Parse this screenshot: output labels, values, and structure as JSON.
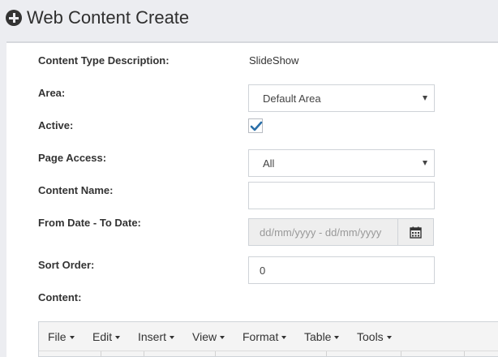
{
  "header": {
    "title": "Web Content Create",
    "icon": "plus-circle-icon"
  },
  "form": {
    "content_type_description": {
      "label": "Content Type Description:",
      "value": "SlideShow"
    },
    "area": {
      "label": "Area:",
      "value": "Default Area"
    },
    "active": {
      "label": "Active:",
      "checked": true
    },
    "page_access": {
      "label": "Page Access:",
      "value": "All"
    },
    "content_name": {
      "label": "Content Name:",
      "value": ""
    },
    "date_range": {
      "label": "From Date - To Date:",
      "placeholder": "dd/mm/yyyy - dd/mm/yyyy",
      "icon": "calendar-icon"
    },
    "sort_order": {
      "label": "Sort Order:",
      "value": "0"
    },
    "content": {
      "label": "Content:"
    }
  },
  "editor": {
    "menus": [
      "File",
      "Edit",
      "Insert",
      "View",
      "Format",
      "Table",
      "Tools"
    ]
  },
  "colors": {
    "checkbox_check": "#2a6fa8",
    "page_bg": "#ecedf1"
  }
}
